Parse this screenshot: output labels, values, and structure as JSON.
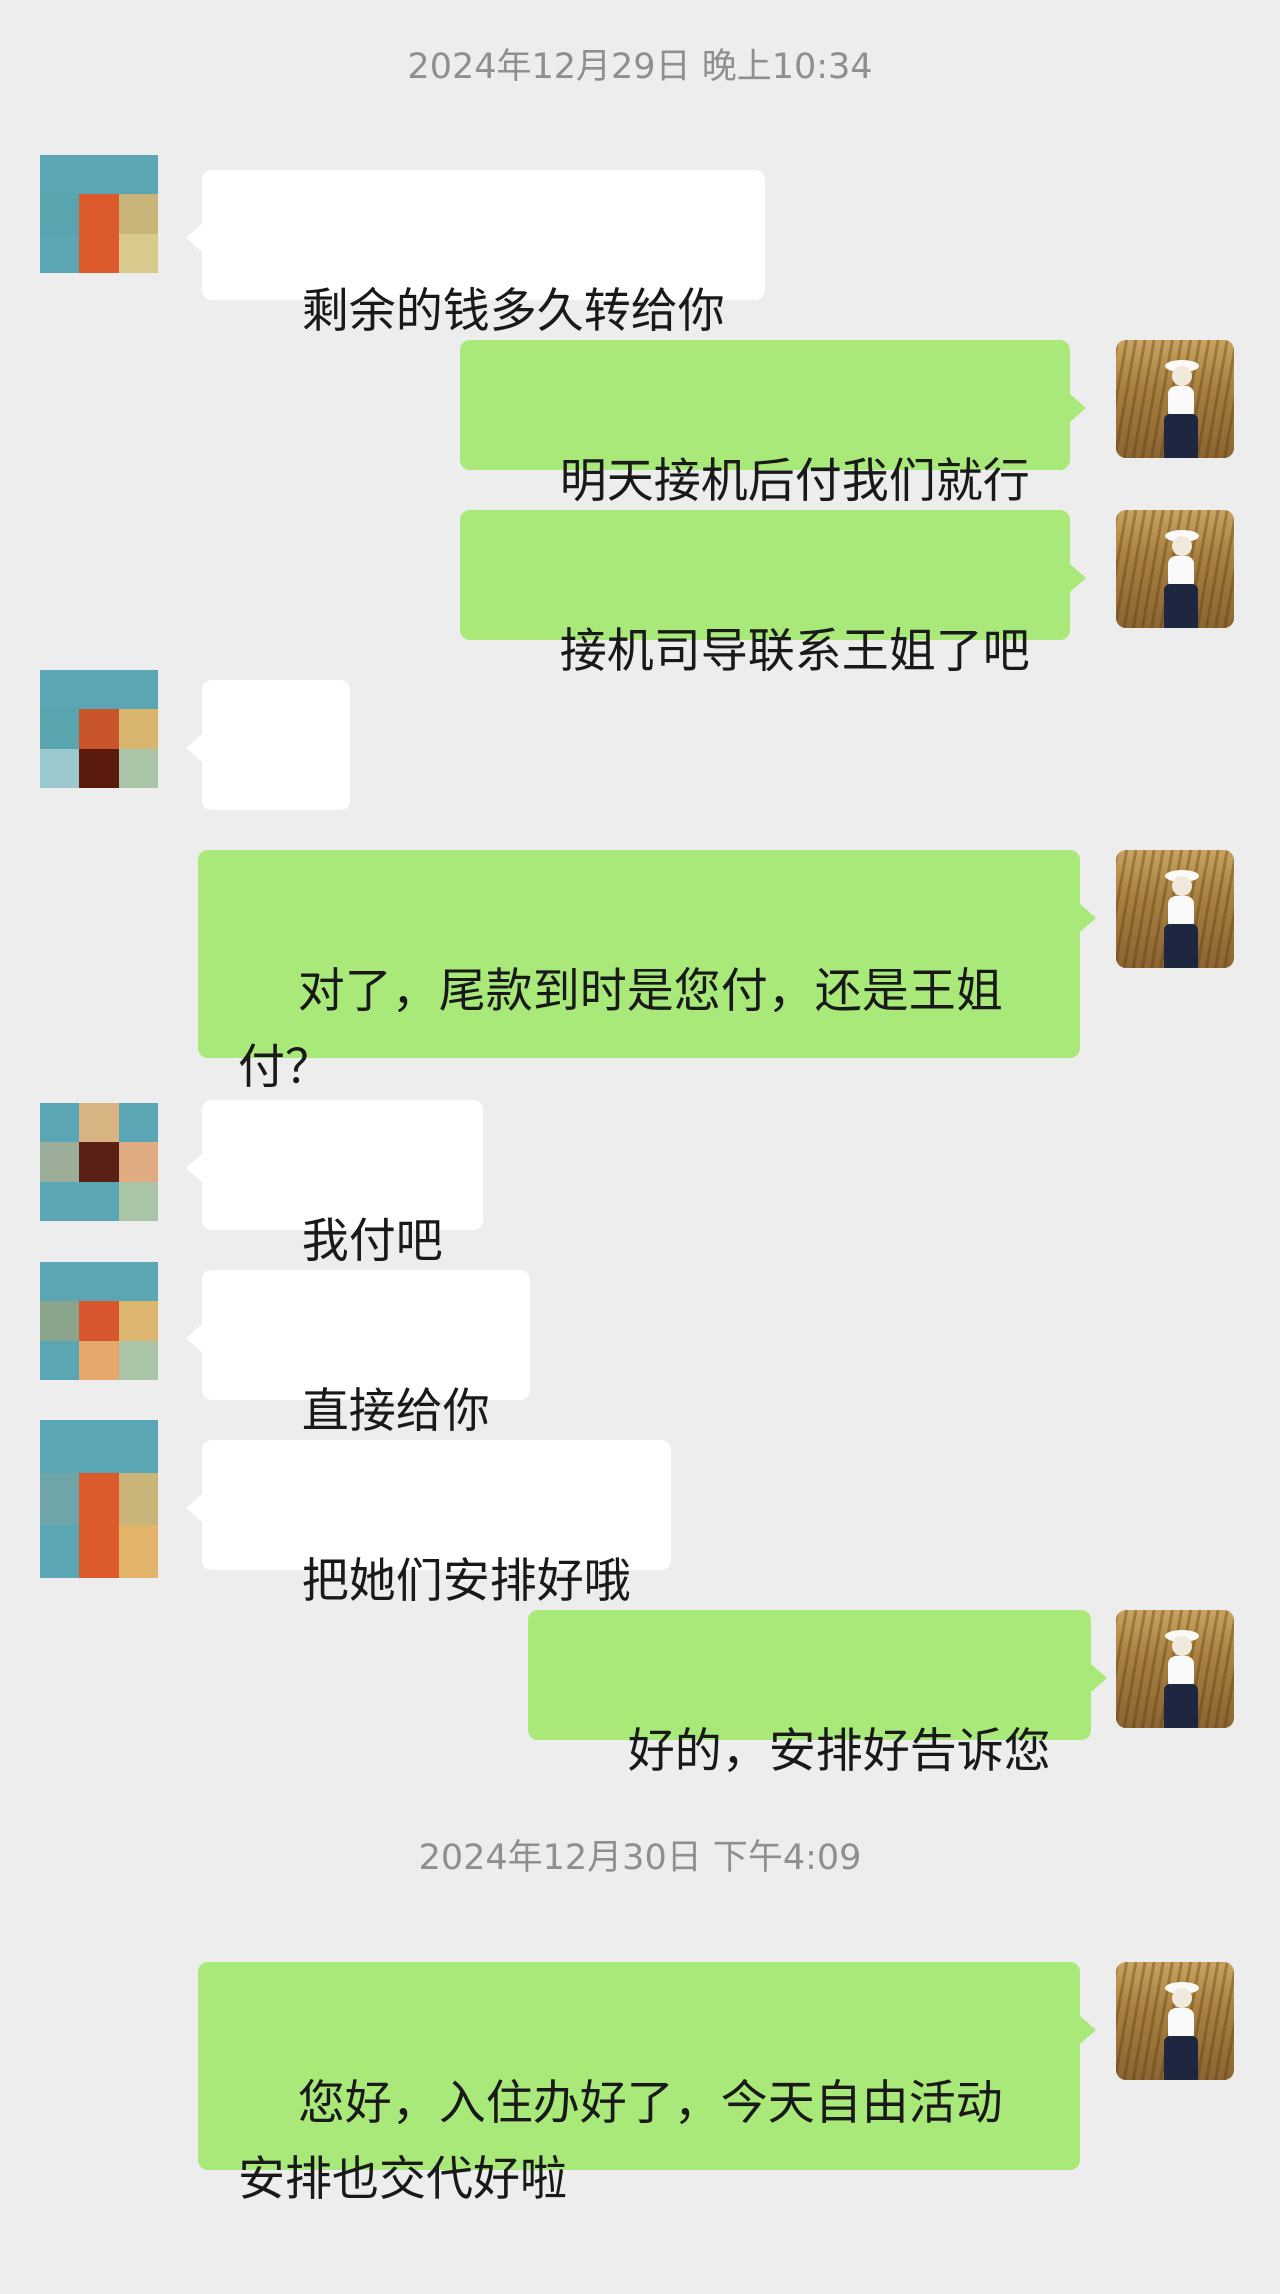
{
  "timestamps": {
    "t1": "2024年12月29日 晚上10:34",
    "t2": "2024年12月30日 下午4:09"
  },
  "messages": [
    {
      "from": "them",
      "text": "剩余的钱多久转给你"
    },
    {
      "from": "me",
      "text": "明天接机后付我们就行"
    },
    {
      "from": "me",
      "text": "接机司导联系王姐了吧"
    },
    {
      "from": "them",
      "emoji": "👌",
      "emoji_name": "ok-hand-icon"
    },
    {
      "from": "me",
      "text": "对了，尾款到时是您付，还是王姐付？"
    },
    {
      "from": "them",
      "text": "我付吧"
    },
    {
      "from": "them",
      "text": "直接给你"
    },
    {
      "from": "them",
      "text": "把她们安排好哦"
    },
    {
      "from": "me",
      "text": "好的，安排好告诉您"
    },
    {
      "from": "me",
      "text": "您好，入住办好了，今天自由活动安排也交代好啦"
    }
  ],
  "colors": {
    "background": "#ededed",
    "me_bubble": "#a9e97a",
    "them_bubble": "#ffffff",
    "timestamp": "#8f8f8f"
  }
}
